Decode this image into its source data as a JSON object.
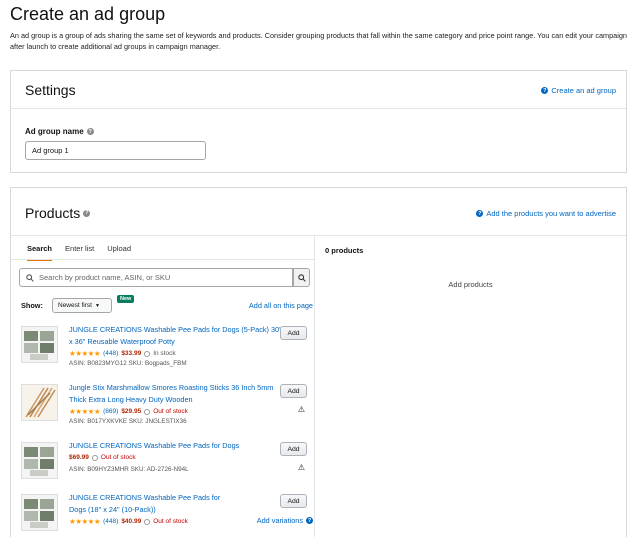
{
  "page": {
    "title": "Create an ad group",
    "description": "An ad group is a group of ads sharing the same set of keywords and products. Consider grouping products that fall within the same category and price point range. You can edit your campaign after launch to create additional ad groups in campaign manager."
  },
  "settings": {
    "title": "Settings",
    "help_link": "Create an ad group",
    "field_label": "Ad group name",
    "field_value": "Ad group 1"
  },
  "products": {
    "title": "Products",
    "help_link": "Add the products you want to advertise",
    "tabs": [
      {
        "label": "Search",
        "active": true
      },
      {
        "label": "Enter list",
        "active": false
      },
      {
        "label": "Upload",
        "active": false
      }
    ],
    "search_placeholder": "Search by product name, ASIN, or SKU",
    "show_label": "Show:",
    "sort_value": "Newest first",
    "new_badge": "New",
    "add_all": "Add all on this page",
    "add_label": "Add",
    "add_variations": "Add variations",
    "items": [
      {
        "title": "JUNGLE CREATIONS Washable Pee Pads for Dogs (5-Pack) 30\" x 36\" Reusable Waterproof Potty",
        "stars": "★★★★★",
        "reviews": "(448)",
        "price": "$33.99",
        "stock": "In stock",
        "asin": "ASIN: B0823MYG12   SKU: Bogpads_FBM"
      },
      {
        "title": "Jungle Stix Marshmallow Smores Roasting Sticks 36 Inch 5mm Thick Extra Long Heavy Duty Wooden",
        "stars": "★★★★★",
        "reviews": "(869)",
        "price": "$29.95",
        "stock": "Out of stock",
        "asin": "ASIN: B017YXKVKE   SKU: JNGLESTIX36"
      },
      {
        "title": "JUNGLE CREATIONS Washable Pee Pads for Dogs",
        "price": "$69.99",
        "stock": "Out of stock",
        "asin": "ASIN: B09HYZ3MHR   SKU: AD-2726-N94L"
      },
      {
        "title": "JUNGLE CREATIONS Washable Pee Pads for Dogs (18\" x 24\" (10-Pack))",
        "stars": "★★★★★",
        "reviews": "(448)",
        "price": "$40.99",
        "stock": "Out of stock"
      }
    ],
    "right_count": "0 products",
    "right_empty": "Add products"
  },
  "colors": {
    "link": "#0066c0",
    "price": "#b12704",
    "star": "#ff9900",
    "active_tab": "#e77600",
    "new_badge": "#067d62"
  }
}
